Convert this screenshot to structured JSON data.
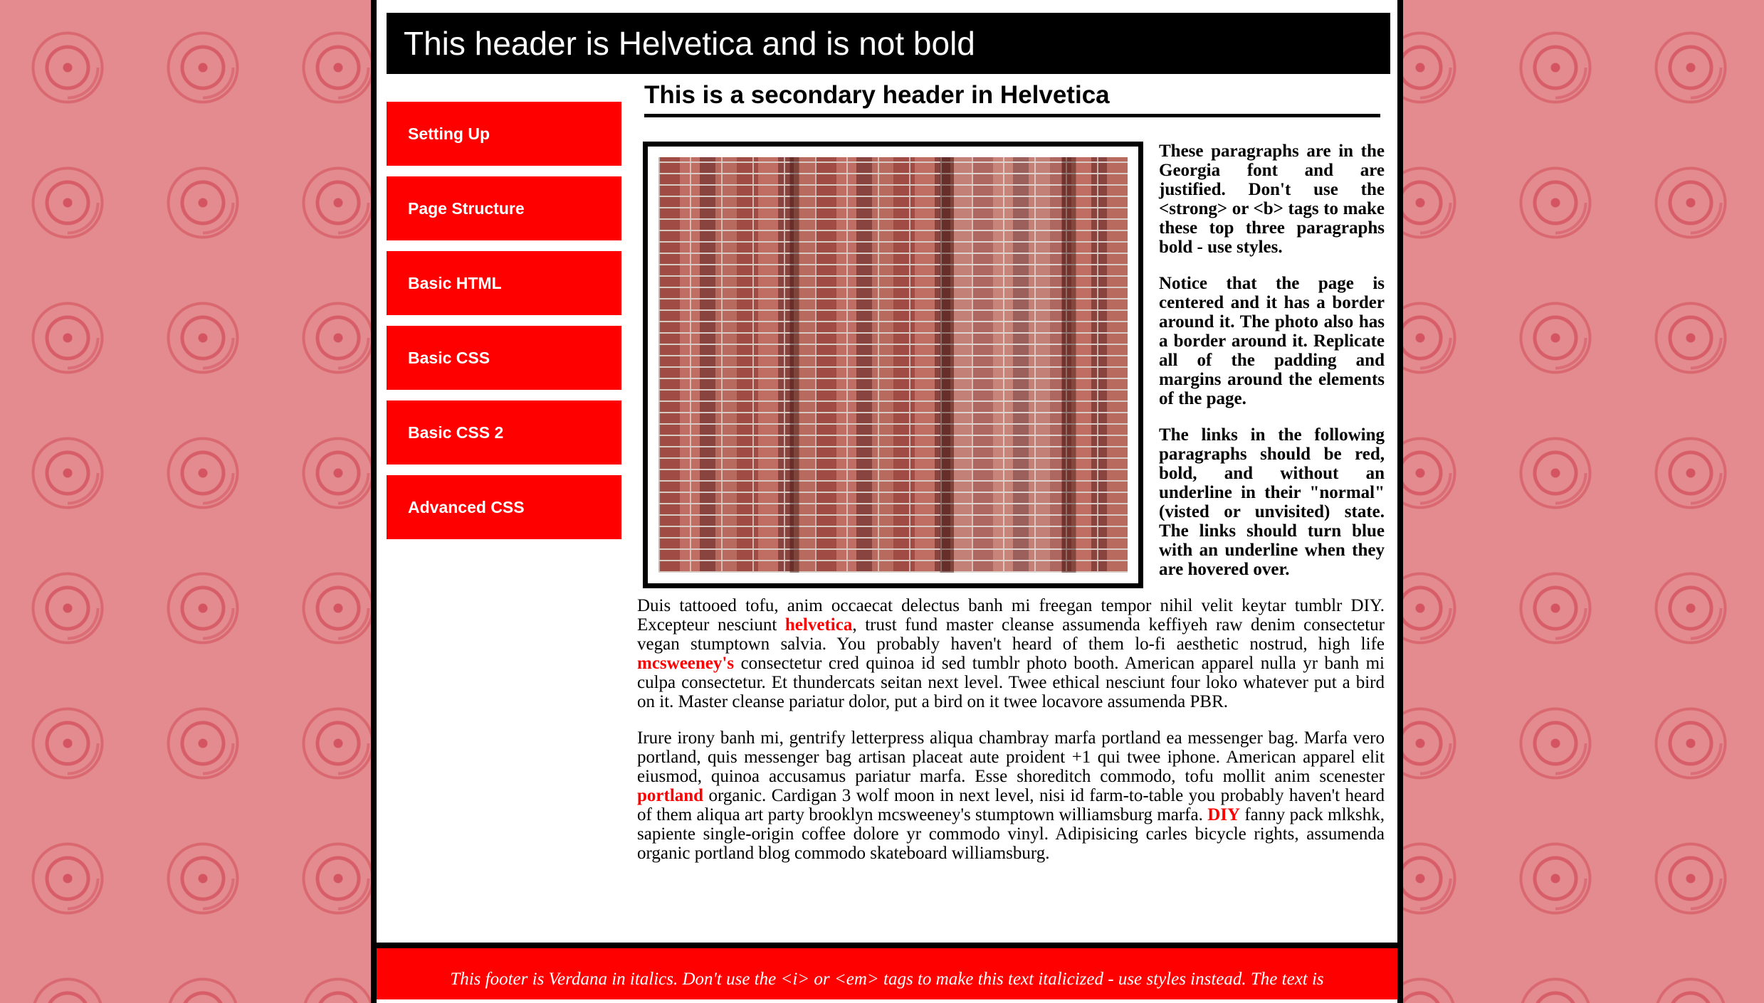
{
  "header": {
    "title": "This header is Helvetica and is not bold"
  },
  "nav": {
    "items": [
      {
        "label": "Setting Up"
      },
      {
        "label": "Page Structure"
      },
      {
        "label": "Basic HTML"
      },
      {
        "label": "Basic CSS"
      },
      {
        "label": "Basic CSS 2"
      },
      {
        "label": "Advanced CSS"
      }
    ]
  },
  "content": {
    "subheader": "This is a secondary header in Helvetica",
    "intro_1": "These paragraphs are in the Georgia font and are justified. Don't use the <strong> or <b> tags to make these top three paragraphs bold - use styles.",
    "intro_2": "Notice that the page is centered and it has a border around it. The photo also has a border around it. Replicate all of the padding and margins around the elements of the page.",
    "intro_3": "The links in the following paragraphs should be red, bold, and without an underline in their \"normal\" (visted or unvisited) state. The links should turn blue with an underline when they are hovered over.",
    "p1": {
      "t1": "Duis tattooed tofu, anim occaecat delectus banh mi freegan tempor nihil velit keytar tumblr DIY. Excepteur nesciunt ",
      "link1": "helvetica",
      "t2": ", trust fund master cleanse assumenda keffiyeh raw denim consectetur vegan stumptown salvia. You probably haven't heard of them lo-fi aesthetic nostrud, high life ",
      "link2": "mcsweeney's",
      "t3": " consectetur cred quinoa id sed tumblr photo booth. American apparel nulla yr banh mi culpa consectetur. Et thundercats seitan next level. Twee ethical nesciunt four loko whatever put a bird on it. Master cleanse pariatur dolor, put a bird on it twee locavore assumenda PBR."
    },
    "p2": {
      "t1": "Irure irony banh mi, gentrify letterpress aliqua chambray marfa portland ea messenger bag. Marfa vero portland, quis messenger bag artisan placeat aute proident +1 qui twee iphone. American apparel elit eiusmod, quinoa accusamus pariatur marfa. Esse shoreditch commodo, tofu mollit anim scenester ",
      "link1": "portland",
      "t2": " organic. Cardigan 3 wolf moon in next level, nisi id farm-to-table you probably haven't heard of them aliqua art party brooklyn mcsweeney's stumptown williamsburg marfa. ",
      "link2": "DIY",
      "t3": " fanny pack mlkshk, sapiente single-origin coffee dolore yr commodo vinyl. Adipisicing carles bicycle rights, assumenda organic portland blog commodo skateboard williamsburg."
    }
  },
  "footer": {
    "text": "This footer is Verdana in italics. Don't use the <i> or <em> tags to make this text italicized - use styles instead. The text is"
  },
  "colors": {
    "accent": "#ff0000",
    "header_bg": "#000000",
    "page_bg": "#e38b8e"
  }
}
